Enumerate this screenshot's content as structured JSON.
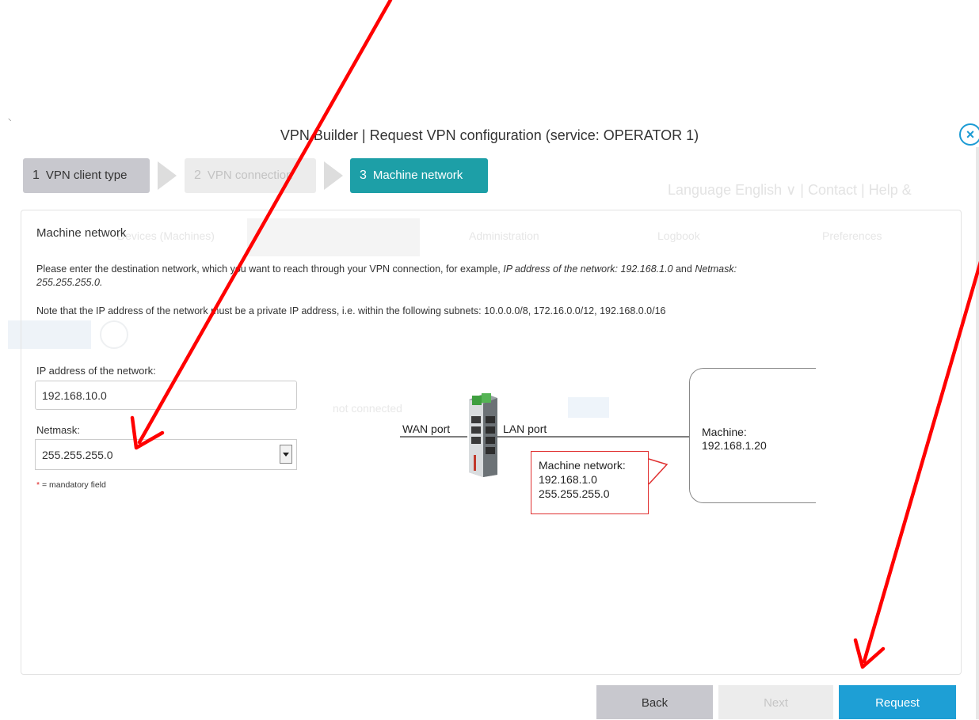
{
  "modal": {
    "title": "VPN Builder | Request VPN configuration (service: OPERATOR 1)",
    "close_glyph": "×"
  },
  "steps": [
    {
      "num": "1",
      "label": "VPN client type",
      "state": "done"
    },
    {
      "num": "2",
      "label": "VPN connection",
      "state": "inactive"
    },
    {
      "num": "3",
      "label": "Machine network",
      "state": "active"
    }
  ],
  "section": {
    "title": "Machine network",
    "para1_a": "Please enter the destination network, which you want to reach through your VPN connection, for example, ",
    "para1_b": "IP address of the network: 192.168.1.0",
    "para1_c": " and ",
    "para1_d": "Netmask: 255.255.255.0.",
    "para2": "Note that the IP address of the network must be a private IP address, i.e. within the following subnets: 10.0.0.0/8, 172.16.0.0/12, 192.168.0.0/16"
  },
  "form": {
    "ip_label": "IP address of the network:",
    "ip_value": "192.168.10.0",
    "netmask_label": "Netmask:",
    "netmask_value": "255.255.255.0",
    "mandatory_star": "*",
    "mandatory_text": " = mandatory field"
  },
  "diagram": {
    "wan_port": "WAN port",
    "lan_port": "LAN port",
    "machine_label": "Machine:",
    "machine_ip": "192.168.1.20",
    "callout_title": "Machine network:",
    "callout_ip": "192.168.1.0",
    "callout_mask": "255.255.255.0"
  },
  "footer": {
    "back": "Back",
    "next": "Next",
    "request": "Request"
  },
  "colors": {
    "accent": "#1e9fd5",
    "step_active": "#1d9fa7",
    "annotation_arrow": "#ff0000",
    "callout_border": "#e03030"
  },
  "background_page": {
    "logo": "",
    "topnav": "Language English ∨  |  Contact  |  Help &",
    "tabs": [
      "Devices (Machines)",
      "",
      "Administration",
      "Logbook",
      "Preferences"
    ],
    "status": "not connected"
  }
}
